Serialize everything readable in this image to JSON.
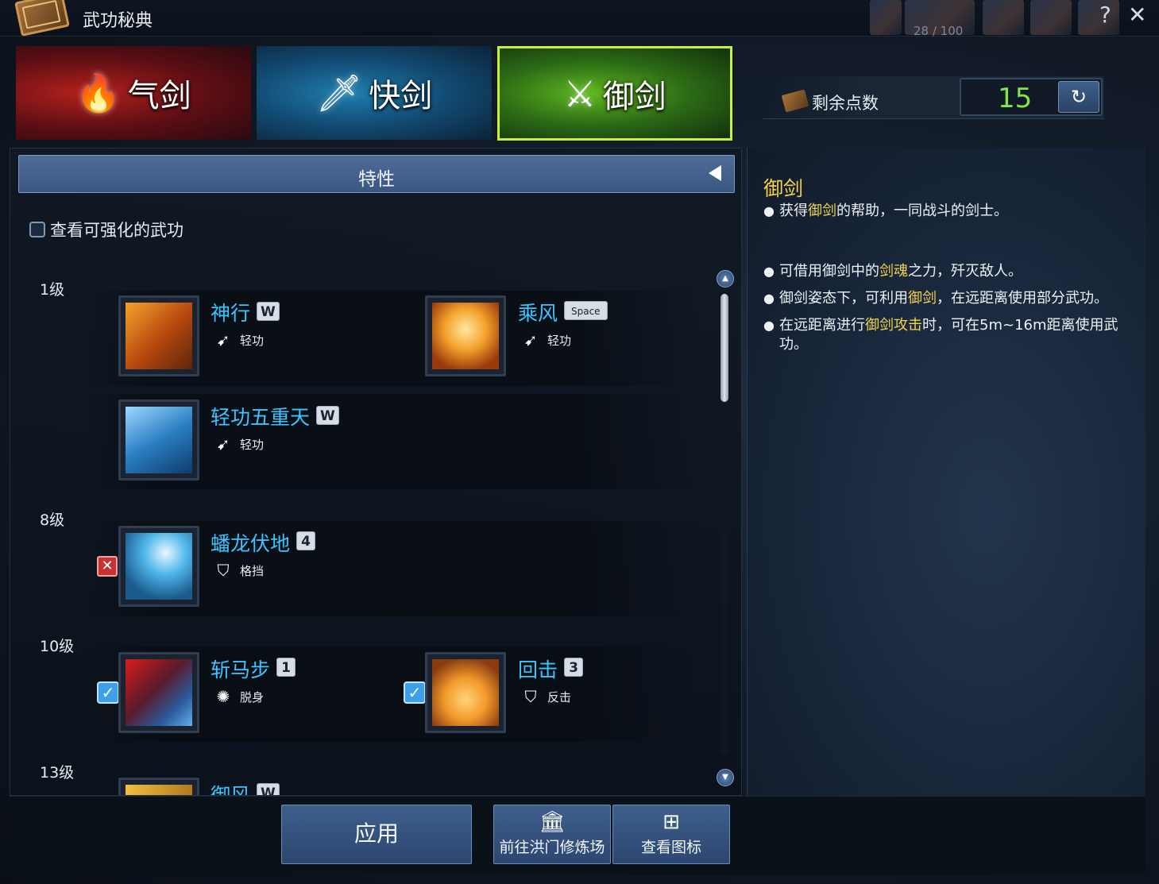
{
  "window": {
    "title": "武功秘典",
    "bag_count": "28 / 100",
    "help": "?",
    "close": "✕"
  },
  "tabs": [
    {
      "label": "气剑",
      "glyph": "🔥"
    },
    {
      "label": "快剑",
      "glyph": "🗡"
    },
    {
      "label": "御剑",
      "glyph": "⚔"
    }
  ],
  "points": {
    "label": "剩余点数",
    "value": "15",
    "reset_glyph": "↻"
  },
  "section": {
    "title": "特性"
  },
  "filter": {
    "label": "查看可强化的武功"
  },
  "levels": [
    {
      "label": "1级"
    },
    {
      "label": "8级"
    },
    {
      "label": "10级"
    },
    {
      "label": "13级"
    }
  ],
  "skills": [
    {
      "name": "神行",
      "key": "W",
      "type": "轻功",
      "type_icon": "dash-icon"
    },
    {
      "name": "乘风",
      "key": "Space",
      "type": "轻功",
      "type_icon": "dash-icon"
    },
    {
      "name": "轻功五重天",
      "key": "W",
      "type": "轻功",
      "type_icon": "dash-icon"
    },
    {
      "name": "蟠龙伏地",
      "key": "4",
      "type": "格挡",
      "type_icon": "shield-icon"
    },
    {
      "name": "斩马步",
      "key": "1",
      "type": "脱身",
      "type_icon": "escape-icon"
    },
    {
      "name": "回击",
      "key": "3",
      "type": "反击",
      "type_icon": "shield-icon"
    },
    {
      "name": "御风",
      "key": "W",
      "type": "",
      "type_icon": ""
    }
  ],
  "buttons": {
    "apply": "应用",
    "training": "前往洪门修炼场",
    "view_icons": "查看图标"
  },
  "description": {
    "title": "御剑",
    "line1": {
      "a": "获得",
      "b": "御剑",
      "c": "的帮助，一同战斗的剑士。"
    },
    "line2": {
      "a": "可借用御剑中的",
      "b": "剑魂",
      "c": "之力，歼灭敌人。"
    },
    "line3": {
      "a": "御剑姿态下，可利用",
      "b": "御剑",
      "c": "，在远距离使用部分武功。"
    },
    "line4": {
      "a": "在远距离进行",
      "b": "御剑攻击",
      "c": "时，可在5m~16m距离使用武功。"
    }
  },
  "colors": {
    "skill_name": "#39c5ff",
    "highlight": "#f4d24a",
    "points": "#7fe64a",
    "active_tab_border": "#c9f03a"
  }
}
